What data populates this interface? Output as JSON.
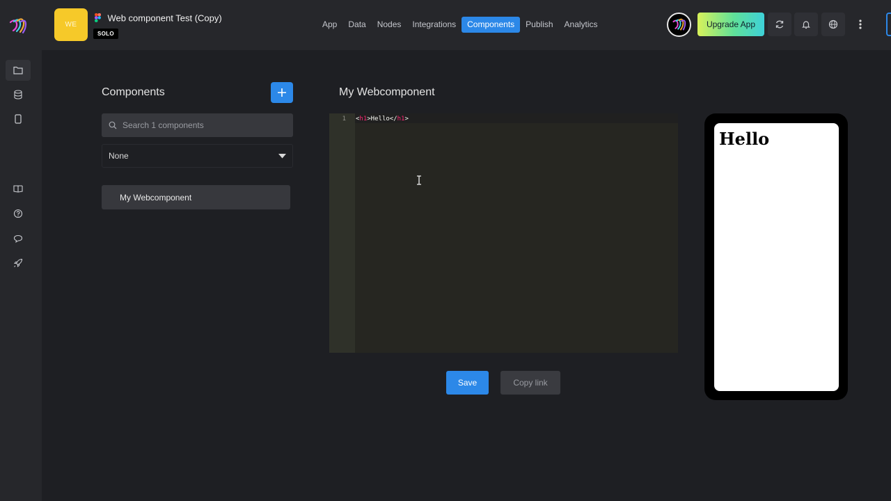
{
  "header": {
    "logo_icon": "rainbow-swirl-logo-icon",
    "app_initials": "WE",
    "app_title": "Web component Test (Copy)",
    "plan_badge": "SOLO",
    "nav": [
      {
        "label": "App",
        "active": false
      },
      {
        "label": "Data",
        "active": false
      },
      {
        "label": "Nodes",
        "active": false
      },
      {
        "label": "Integrations",
        "active": false
      },
      {
        "label": "Components",
        "active": true
      },
      {
        "label": "Publish",
        "active": false
      },
      {
        "label": "Analytics",
        "active": false
      }
    ],
    "upgrade_label": "Upgrade App",
    "icons": [
      "refresh-icon",
      "bell-icon",
      "globe-icon",
      "more-vertical-icon"
    ]
  },
  "sidebar": {
    "icons": [
      "folder-icon",
      "database-icon",
      "phone-icon",
      "book-icon",
      "help-icon",
      "chat-icon",
      "rocket-icon"
    ]
  },
  "components_panel": {
    "title": "Components",
    "search_placeholder": "Search 1 components",
    "filter_value": "None",
    "items": [
      "My Webcomponent"
    ]
  },
  "editor": {
    "title": "My Webcomponent",
    "line_number": "1",
    "code_open": "<",
    "code_tag": "h1",
    "code_mid": ">Hello</",
    "code_close": ">"
  },
  "actions": {
    "save_label": "Save",
    "copy_link_label": "Copy link"
  },
  "preview": {
    "heading": "Hello"
  },
  "colors": {
    "accent": "#2c88e8",
    "app_avatar": "#f6c929",
    "background": "#1e1f23",
    "topbar": "#26272b"
  }
}
